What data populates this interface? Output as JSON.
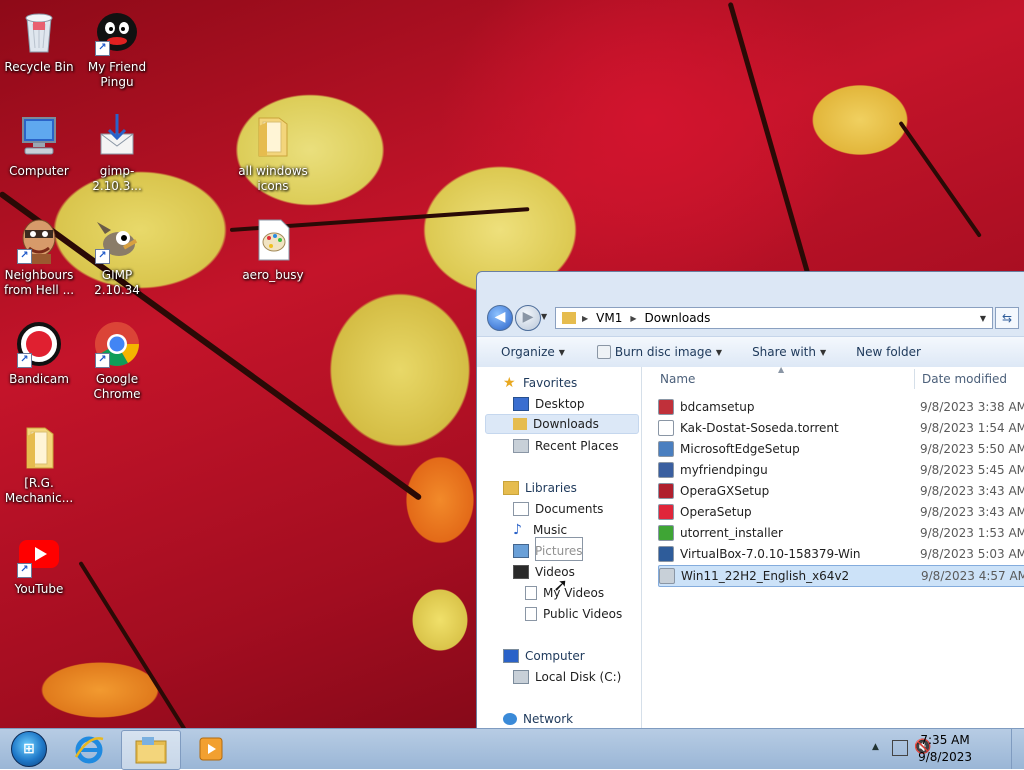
{
  "desktop_icons": [
    {
      "label": "Recycle Bin",
      "icon": "recycle-bin-icon"
    },
    {
      "label": "My Friend Pingu",
      "icon": "penguin-icon"
    },
    {
      "label": "Computer",
      "icon": "computer-icon"
    },
    {
      "label": "gimp-2.10.3...",
      "icon": "installer-download-icon"
    },
    {
      "label": "all windows icons",
      "icon": "folder-icon"
    },
    {
      "label": "Neighbours from Hell ...",
      "icon": "game-character-icon"
    },
    {
      "label": "GIMP 2.10.34",
      "icon": "gimp-icon"
    },
    {
      "label": "aero_busy",
      "icon": "paint-palette-icon"
    },
    {
      "label": "Bandicam",
      "icon": "record-icon"
    },
    {
      "label": "Google Chrome",
      "icon": "chrome-icon"
    },
    {
      "label": "[R.G. Mechanic...",
      "icon": "folder-icon"
    },
    {
      "label": "YouTube",
      "icon": "youtube-icon"
    }
  ],
  "explorer": {
    "breadcrumb": [
      "VM1",
      "Downloads"
    ],
    "commands": {
      "organize": "Organize",
      "burn": "Burn disc image",
      "share": "Share with",
      "new_folder": "New folder"
    },
    "nav": {
      "favorites": "Favorites",
      "desktop": "Desktop",
      "downloads": "Downloads",
      "recent": "Recent Places",
      "libraries": "Libraries",
      "documents": "Documents",
      "music": "Music",
      "pictures": "Pictures",
      "videos": "Videos",
      "my_videos": "My Videos",
      "public_videos": "Public Videos",
      "computer": "Computer",
      "local_disk": "Local Disk (C:)",
      "network": "Network"
    },
    "columns": {
      "name": "Name",
      "date": "Date modified"
    },
    "files": [
      {
        "name": "bdcamsetup",
        "date": "9/8/2023 3:38 AM",
        "color": "#c0303a"
      },
      {
        "name": "Kak-Dostat-Soseda.torrent",
        "date": "9/8/2023 1:54 AM",
        "color": "#ffffff"
      },
      {
        "name": "MicrosoftEdgeSetup",
        "date": "9/8/2023 5:50 AM",
        "color": "#4a7fc0"
      },
      {
        "name": "myfriendpingu",
        "date": "9/8/2023 5:45 AM",
        "color": "#3a5fa0"
      },
      {
        "name": "OperaGXSetup",
        "date": "9/8/2023 3:43 AM",
        "color": "#b0202e"
      },
      {
        "name": "OperaSetup",
        "date": "9/8/2023 3:43 AM",
        "color": "#e0263a"
      },
      {
        "name": "utorrent_installer",
        "date": "9/8/2023 1:53 AM",
        "color": "#3fa535"
      },
      {
        "name": "VirtualBox-7.0.10-158379-Win",
        "date": "9/8/2023 5:03 AM",
        "color": "#2e5c9a"
      },
      {
        "name": "Win11_22H2_English_x64v2",
        "date": "9/8/2023 4:57 AM",
        "color": "#c8d0d8"
      }
    ]
  },
  "taskbar": {
    "clock_time": "7:35 AM",
    "clock_date": "9/8/2023"
  }
}
